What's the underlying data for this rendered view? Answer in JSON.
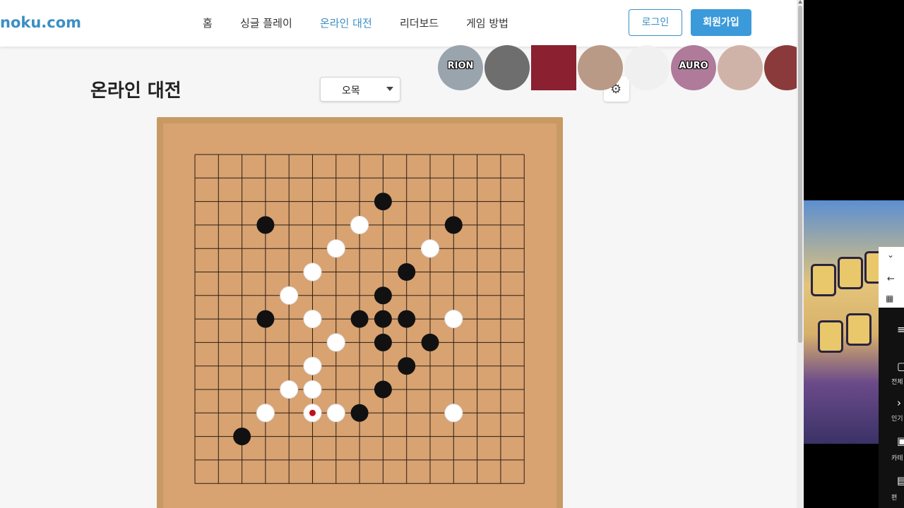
{
  "header": {
    "brand": "noku.com",
    "nav": [
      "홈",
      "싱글 플레이",
      "온라인 대전",
      "리더보드",
      "게임 방법"
    ],
    "active_nav": "온라인 대전",
    "login_label": "로그인",
    "signup_label": "회원가입"
  },
  "main": {
    "title": "온라인 대전",
    "game_select": {
      "value": "오목"
    }
  },
  "overlay_avatars": [
    {
      "label": "RION",
      "color": "#9aa4ad"
    },
    {
      "label": "",
      "color": "#6e6e6e"
    },
    {
      "label": "",
      "color": "#8a2030"
    },
    {
      "label": "",
      "color": "#b99a86"
    },
    {
      "label": "",
      "color": "#f0f0f0"
    },
    {
      "label": "AURO",
      "color": "#b07a9a"
    },
    {
      "label": "",
      "color": "#d0b3a8"
    },
    {
      "label": "",
      "color": "#8a3a3a"
    },
    {
      "label": "",
      "color": "#7d8aa0"
    },
    {
      "label": "",
      "color": "#b89a86"
    }
  ],
  "board": {
    "size": 15,
    "black_stones": [
      [
        8,
        2
      ],
      [
        3,
        3
      ],
      [
        11,
        3
      ],
      [
        9,
        5
      ],
      [
        8,
        6
      ],
      [
        3,
        7
      ],
      [
        7,
        7
      ],
      [
        8,
        7
      ],
      [
        9,
        7
      ],
      [
        8,
        8
      ],
      [
        10,
        8
      ],
      [
        9,
        9
      ],
      [
        8,
        10
      ],
      [
        7,
        11
      ],
      [
        2,
        12
      ]
    ],
    "white_stones": [
      [
        7,
        3
      ],
      [
        6,
        4
      ],
      [
        10,
        4
      ],
      [
        5,
        5
      ],
      [
        4,
        6
      ],
      [
        5,
        7
      ],
      [
        11,
        7
      ],
      [
        6,
        8
      ],
      [
        5,
        9
      ],
      [
        4,
        10
      ],
      [
        5,
        10
      ],
      [
        3,
        11
      ],
      [
        5,
        11
      ],
      [
        6,
        11
      ],
      [
        11,
        11
      ]
    ],
    "last_move": [
      5,
      11
    ]
  },
  "side_panel": {
    "labels": [
      "전체",
      "인기",
      "카테",
      "편"
    ]
  }
}
